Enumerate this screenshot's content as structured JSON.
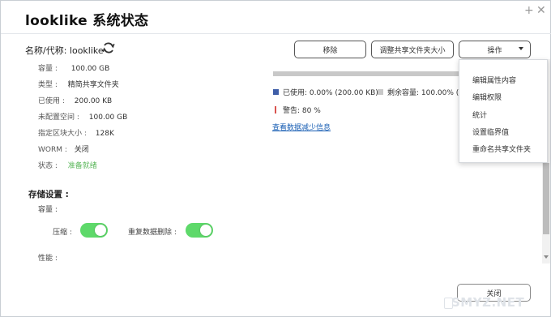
{
  "window": {
    "title": "looklike  系统状态",
    "plus_glyph": "+",
    "close_glyph": "✕"
  },
  "left": {
    "name_label": "名称/代称: looklike",
    "info": [
      {
        "key": "容量 :",
        "value": "100.00 GB"
      },
      {
        "key": "类型 :",
        "value": "精简共享文件夹"
      },
      {
        "key": "已使用 :",
        "value": "200.00 KB"
      },
      {
        "key": "未配置空间 :",
        "value": "100.00 GB"
      },
      {
        "key": "指定区块大小 :",
        "value": "128K"
      },
      {
        "key": "WORM :",
        "value": "关闭"
      },
      {
        "key": "状态 :",
        "value": "准备就绪"
      }
    ],
    "storage_title": "存储设置 :",
    "capacity_label": "容量 :",
    "compress_label": "压缩 :",
    "dedup_label": "重复数据删除 :",
    "performance_label": "性能 :",
    "compress_on": true,
    "dedup_on": true
  },
  "toolbar": {
    "remove_label": "移除",
    "resize_label": "调整共享文件夹大小",
    "ops_label": "操作"
  },
  "usage": {
    "used_fraction": 0.0,
    "used_text": "已使用: 0.00% (200.00 KB)",
    "remaining_text": "剩余容量: 100.00% (",
    "warning_text": "警告: 80 %",
    "link_text": "查看数据减少信息",
    "used_color": "#3f5ea8",
    "remaining_color": "#c8c8c8",
    "warning_color": "#d9534f"
  },
  "menu": {
    "items": [
      "编辑属性内容",
      "编辑权限",
      "统计",
      "设置临界值",
      "重命名共享文件夹"
    ]
  },
  "footer": {
    "close_label": "关闭"
  },
  "watermark": {
    "text": "SMYZ.NET"
  }
}
